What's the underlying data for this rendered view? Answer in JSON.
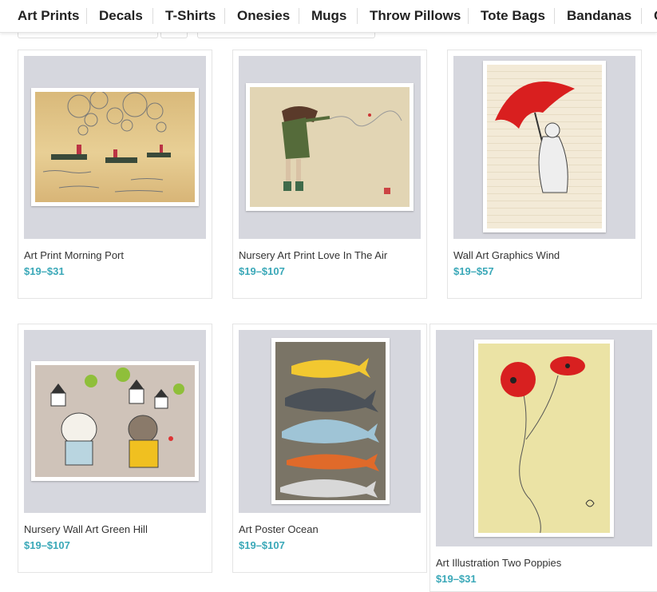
{
  "nav": {
    "items": [
      "Art Prints",
      "Decals",
      "T-Shirts",
      "Onesies",
      "Mugs",
      "Throw Pillows",
      "Tote Bags",
      "Bandanas",
      "C"
    ]
  },
  "products": [
    {
      "title": "Art Print Morning Port",
      "price": "$19–$31",
      "art_icon": "boats-illustration-icon"
    },
    {
      "title": "Nursery Art Print Love In The Air",
      "price": "$19–$107",
      "art_icon": "girl-wind-illustration-icon"
    },
    {
      "title": "Wall Art Graphics Wind",
      "price": "$19–$57",
      "art_icon": "umbrella-girl-illustration-icon"
    },
    {
      "title": "Nursery Wall Art Green Hill",
      "price": "$19–$107",
      "art_icon": "animals-village-illustration-icon"
    },
    {
      "title": "Art Poster Ocean",
      "price": "$19–$107",
      "art_icon": "whales-illustration-icon"
    },
    {
      "title": "Art Illustration Two Poppies",
      "price": "$19–$31",
      "art_icon": "poppies-illustration-icon"
    }
  ],
  "colors": {
    "price": "#3aa8b8",
    "frame": "#d6d7de",
    "nav_text": "#222222"
  }
}
